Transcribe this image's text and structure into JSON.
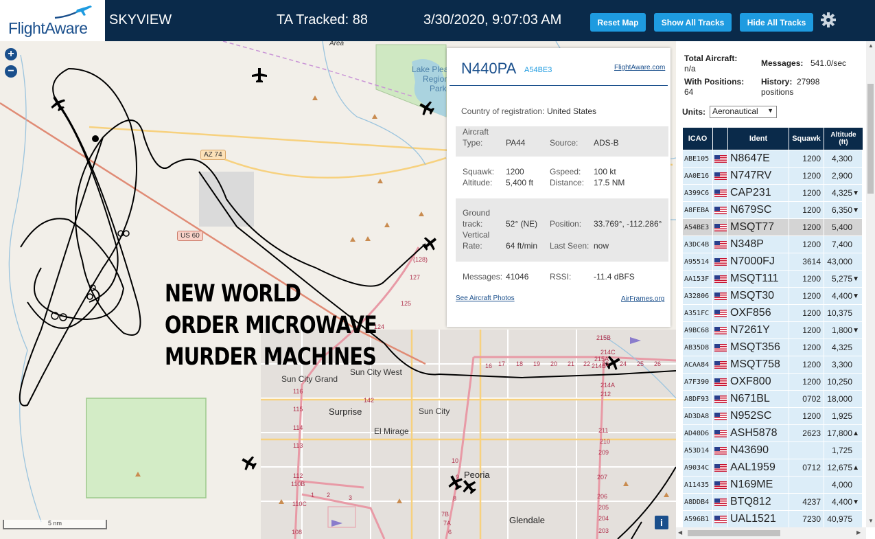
{
  "header": {
    "logo_text": "FlightAware",
    "app_name": "SKYVIEW",
    "tracked": "TA Tracked: 88",
    "datetime": "3/30/2020, 9:07:03 AM",
    "reset_map": "Reset Map",
    "show_all_tracks": "Show All Tracks",
    "hide_all_tracks": "Hide All Tracks",
    "settings_icon": "gear-icon"
  },
  "map": {
    "zoom_in": "+",
    "zoom_out": "−",
    "overlay_text": [
      "NEW WORLD",
      "ORDER MICROWAVE",
      "MURDER MACHINES"
    ],
    "places": {
      "area": "Area",
      "lake_line1": "Lake Plea",
      "lake_line2": "Region",
      "lake_line3": "Park",
      "sun_city_grand": "Sun City Grand",
      "sun_city_west": "Sun City West",
      "surprise": "Surprise",
      "sun_city": "Sun City",
      "el_mirage": "El Mirage",
      "peoria": "Peoria",
      "glendale": "Glendale"
    },
    "highways": {
      "az74": "AZ 74",
      "us60": "US 60"
    },
    "exits": [
      "(128)",
      "127",
      "125",
      "124",
      "116",
      "115",
      "114",
      "113",
      "112",
      "110B",
      "110C",
      "108",
      "142",
      "10",
      "9",
      "8",
      "7B",
      "7A",
      "6",
      "215B",
      "214C",
      "215A",
      "214B",
      "214A",
      "212",
      "211",
      "210",
      "209",
      "207",
      "206",
      "205",
      "204",
      "203",
      "16",
      "17",
      "18",
      "19",
      "20",
      "21",
      "22",
      "23",
      "24",
      "25",
      "26",
      "1",
      "2",
      "3"
    ],
    "scale_label": "5 nm",
    "info_button": "i"
  },
  "popup": {
    "callsign": "N440PA",
    "hex": "A54BE3",
    "fa_link": "FlightAware.com",
    "country_label": "Country of registration:",
    "country_value": "United States",
    "aircraft_type_label_1": "Aircraft",
    "aircraft_type_label_2": "Type:",
    "aircraft_type_value": "PA44",
    "source_label": "Source:",
    "source_value": "ADS-B",
    "squawk_label": "Squawk:",
    "squawk_value": "1200",
    "gspeed_label": "Gspeed:",
    "gspeed_value": "100 kt",
    "altitude_label": "Altitude:",
    "altitude_value": "5,400 ft",
    "distance_label": "Distance:",
    "distance_value": "17.5 NM",
    "ground_track_label_1": "Ground",
    "ground_track_label_2": "track:",
    "ground_track_value": "52° (NE)",
    "position_label": "Position:",
    "position_value": "33.769°, -112.286°",
    "vrate_label_1": "Vertical",
    "vrate_label_2": "Rate:",
    "vrate_value": "64 ft/min",
    "last_seen_label": "Last Seen:",
    "last_seen_value": "now",
    "messages_label": "Messages:",
    "messages_value": "41046",
    "rssi_label": "RSSI:",
    "rssi_value": "-11.4 dBFS",
    "photos_link": "See Aircraft Photos",
    "airframes_link": "AirFrames.org"
  },
  "panel": {
    "total_aircraft_label": "Total Aircraft:",
    "total_aircraft_value": "n/a",
    "with_positions_label": "With Positions:",
    "with_positions_value": "64",
    "messages_label": "Messages:",
    "messages_value": "541.0/sec",
    "history_label": "History:",
    "history_value": "27998",
    "history_unit": "positions",
    "units_label": "Units:",
    "units_value": "Aeronautical",
    "columns": {
      "icao": "ICAO",
      "ident": "Ident",
      "squawk": "Squawk",
      "altitude_1": "Altitude",
      "altitude_2": "(ft)"
    },
    "rows": [
      {
        "icao": "ABE105",
        "ident": "N8647E",
        "squawk": "1200",
        "alt": "4,300",
        "trend": ""
      },
      {
        "icao": "AA0E16",
        "ident": "N747RV",
        "squawk": "1200",
        "alt": "2,900",
        "trend": ""
      },
      {
        "icao": "A399C6",
        "ident": "CAP231",
        "squawk": "1200",
        "alt": "4,325",
        "trend": "▼"
      },
      {
        "icao": "A8FEBA",
        "ident": "N679SC",
        "squawk": "1200",
        "alt": "6,350",
        "trend": "▼"
      },
      {
        "icao": "A54BE3",
        "ident": "MSQT77",
        "squawk": "1200",
        "alt": "5,400",
        "trend": "",
        "selected": true
      },
      {
        "icao": "A3DC4B",
        "ident": "N348P",
        "squawk": "1200",
        "alt": "7,400",
        "trend": ""
      },
      {
        "icao": "A95514",
        "ident": "N7000FJ",
        "squawk": "3614",
        "alt": "43,000",
        "trend": ""
      },
      {
        "icao": "AA153F",
        "ident": "MSQT111",
        "squawk": "1200",
        "alt": "5,275",
        "trend": "▼"
      },
      {
        "icao": "A32806",
        "ident": "MSQT30",
        "squawk": "1200",
        "alt": "4,400",
        "trend": "▼"
      },
      {
        "icao": "A351FC",
        "ident": "OXF856",
        "squawk": "1200",
        "alt": "10,375",
        "trend": ""
      },
      {
        "icao": "A9BC68",
        "ident": "N7261Y",
        "squawk": "1200",
        "alt": "1,800",
        "trend": "▼"
      },
      {
        "icao": "AB35D8",
        "ident": "MSQT356",
        "squawk": "1200",
        "alt": "4,325",
        "trend": ""
      },
      {
        "icao": "ACAA84",
        "ident": "MSQT758",
        "squawk": "1200",
        "alt": "3,300",
        "trend": ""
      },
      {
        "icao": "A7F390",
        "ident": "OXF800",
        "squawk": "1200",
        "alt": "10,250",
        "trend": ""
      },
      {
        "icao": "A8DF93",
        "ident": "N671BL",
        "squawk": "0702",
        "alt": "18,000",
        "trend": ""
      },
      {
        "icao": "AD3DA8",
        "ident": "N952SC",
        "squawk": "1200",
        "alt": "1,925",
        "trend": ""
      },
      {
        "icao": "AD40D6",
        "ident": "ASH5878",
        "squawk": "2623",
        "alt": "17,800",
        "trend": "▲"
      },
      {
        "icao": "A53D14",
        "ident": "N43690",
        "squawk": "",
        "alt": "1,725",
        "trend": ""
      },
      {
        "icao": "A9034C",
        "ident": "AAL1959",
        "squawk": "0712",
        "alt": "12,675",
        "trend": "▲"
      },
      {
        "icao": "A11435",
        "ident": "N169ME",
        "squawk": "",
        "alt": "4,000",
        "trend": ""
      },
      {
        "icao": "A8DDB4",
        "ident": "BTQ812",
        "squawk": "4237",
        "alt": "4,400",
        "trend": "▼"
      },
      {
        "icao": "A596B1",
        "ident": "UAL1521",
        "squawk": "7230",
        "alt": "40,975",
        "trend": ""
      }
    ]
  },
  "colors": {
    "header_bg": "#0a2a4a",
    "button": "#1e9be0",
    "brand": "#1a4f8c",
    "row_bg": "#dcedf8",
    "row_selected": "#d4d4d4"
  }
}
